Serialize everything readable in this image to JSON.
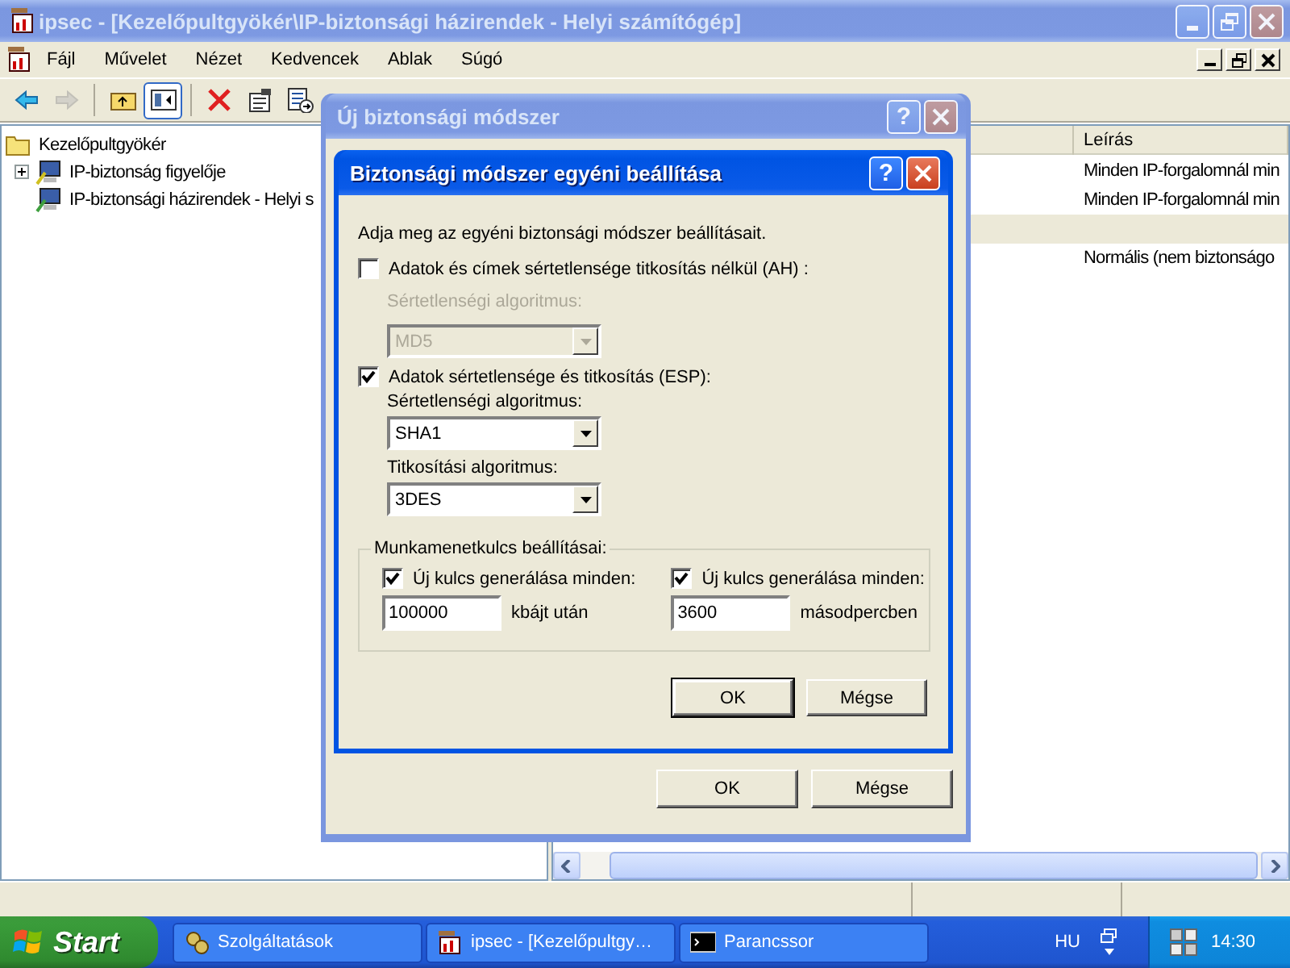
{
  "main_window": {
    "title": "ipsec - [Kezelőpultgyökér\\IP-biztonsági házirendek - Helyi számítógép]",
    "active": false
  },
  "menu": [
    "Fájl",
    "Művelet",
    "Nézet",
    "Kedvencek",
    "Ablak",
    "Súgó"
  ],
  "toolbar": [
    {
      "kind": "back",
      "disabled": false,
      "pressed": false
    },
    {
      "kind": "forward",
      "disabled": true,
      "pressed": false
    },
    {
      "kind": "up",
      "disabled": false,
      "pressed": false
    },
    {
      "kind": "tree",
      "disabled": false,
      "pressed": true
    },
    {
      "kind": "delete",
      "disabled": false,
      "pressed": false
    },
    {
      "kind": "properties",
      "disabled": false,
      "pressed": false
    },
    {
      "kind": "export",
      "disabled": false,
      "pressed": false
    }
  ],
  "tree": [
    {
      "label": "Kezelőpultgyökér",
      "kind": "folder",
      "children": [
        {
          "label": "IP-biztonság figyelője",
          "kind": "monitor",
          "expanded": false
        },
        {
          "label": "IP-biztonsági házirendek - Helyi s",
          "kind": "policy"
        }
      ]
    }
  ],
  "list": {
    "columns": [
      "Leírás"
    ],
    "rows": [
      {
        "description": "Minden IP-forgalomnál min",
        "selected": false
      },
      {
        "description": "Minden IP-forgalomnál min",
        "selected": false
      },
      {
        "selected": true
      },
      {
        "description": "Normális (nem biztonságo",
        "selected": false
      }
    ]
  },
  "policy_dialog": {
    "title": "Új biztonsági módszer",
    "active": false,
    "help": "?",
    "buttons": [
      {
        "label": "OK",
        "default": false
      },
      {
        "label": "Mégse",
        "default": false
      }
    ]
  },
  "custom_dialog": {
    "title": "Biztonsági módszer egyéni beállítása",
    "active": true,
    "help": "?",
    "intro": "Adja meg az egyéni biztonsági módszer beállításait.",
    "ah": {
      "label": "Adatok és címek sértetlensége titkosítás nélkül (AH) :",
      "checked": false,
      "integrity_label": "Sértetlenségi algoritmus:",
      "integrity_value": "MD5"
    },
    "esp": {
      "label": "Adatok sértetlensége és titkosítás (ESP):",
      "checked": true,
      "integrity_label": "Sértetlenségi algoritmus:",
      "integrity_value": "SHA1",
      "encryption_label": "Titkosítási algoritmus:",
      "encryption_value": "3DES"
    },
    "session_keys": {
      "title": "Munkamenetkulcs beállításai:",
      "items": [
        {
          "label": "Új kulcs generálása minden:",
          "checked": true,
          "value": "100000",
          "unit": "kbájt után"
        },
        {
          "label": "Új kulcs generálása minden:",
          "checked": true,
          "value": "3600",
          "unit": "másodpercben"
        }
      ]
    },
    "buttons": [
      {
        "label": "OK",
        "default": true
      },
      {
        "label": "Mégse",
        "default": false
      }
    ]
  },
  "taskbar": {
    "start": "Start",
    "tasks": [
      {
        "label": "Szolgáltatások",
        "kind": "services",
        "selected": false
      },
      {
        "label": "ipsec - [Kezelőpultgy…",
        "kind": "mmc",
        "selected": false
      },
      {
        "label": "Parancssor",
        "kind": "console",
        "selected": false
      }
    ],
    "language": "HU",
    "clock": "14:30"
  }
}
